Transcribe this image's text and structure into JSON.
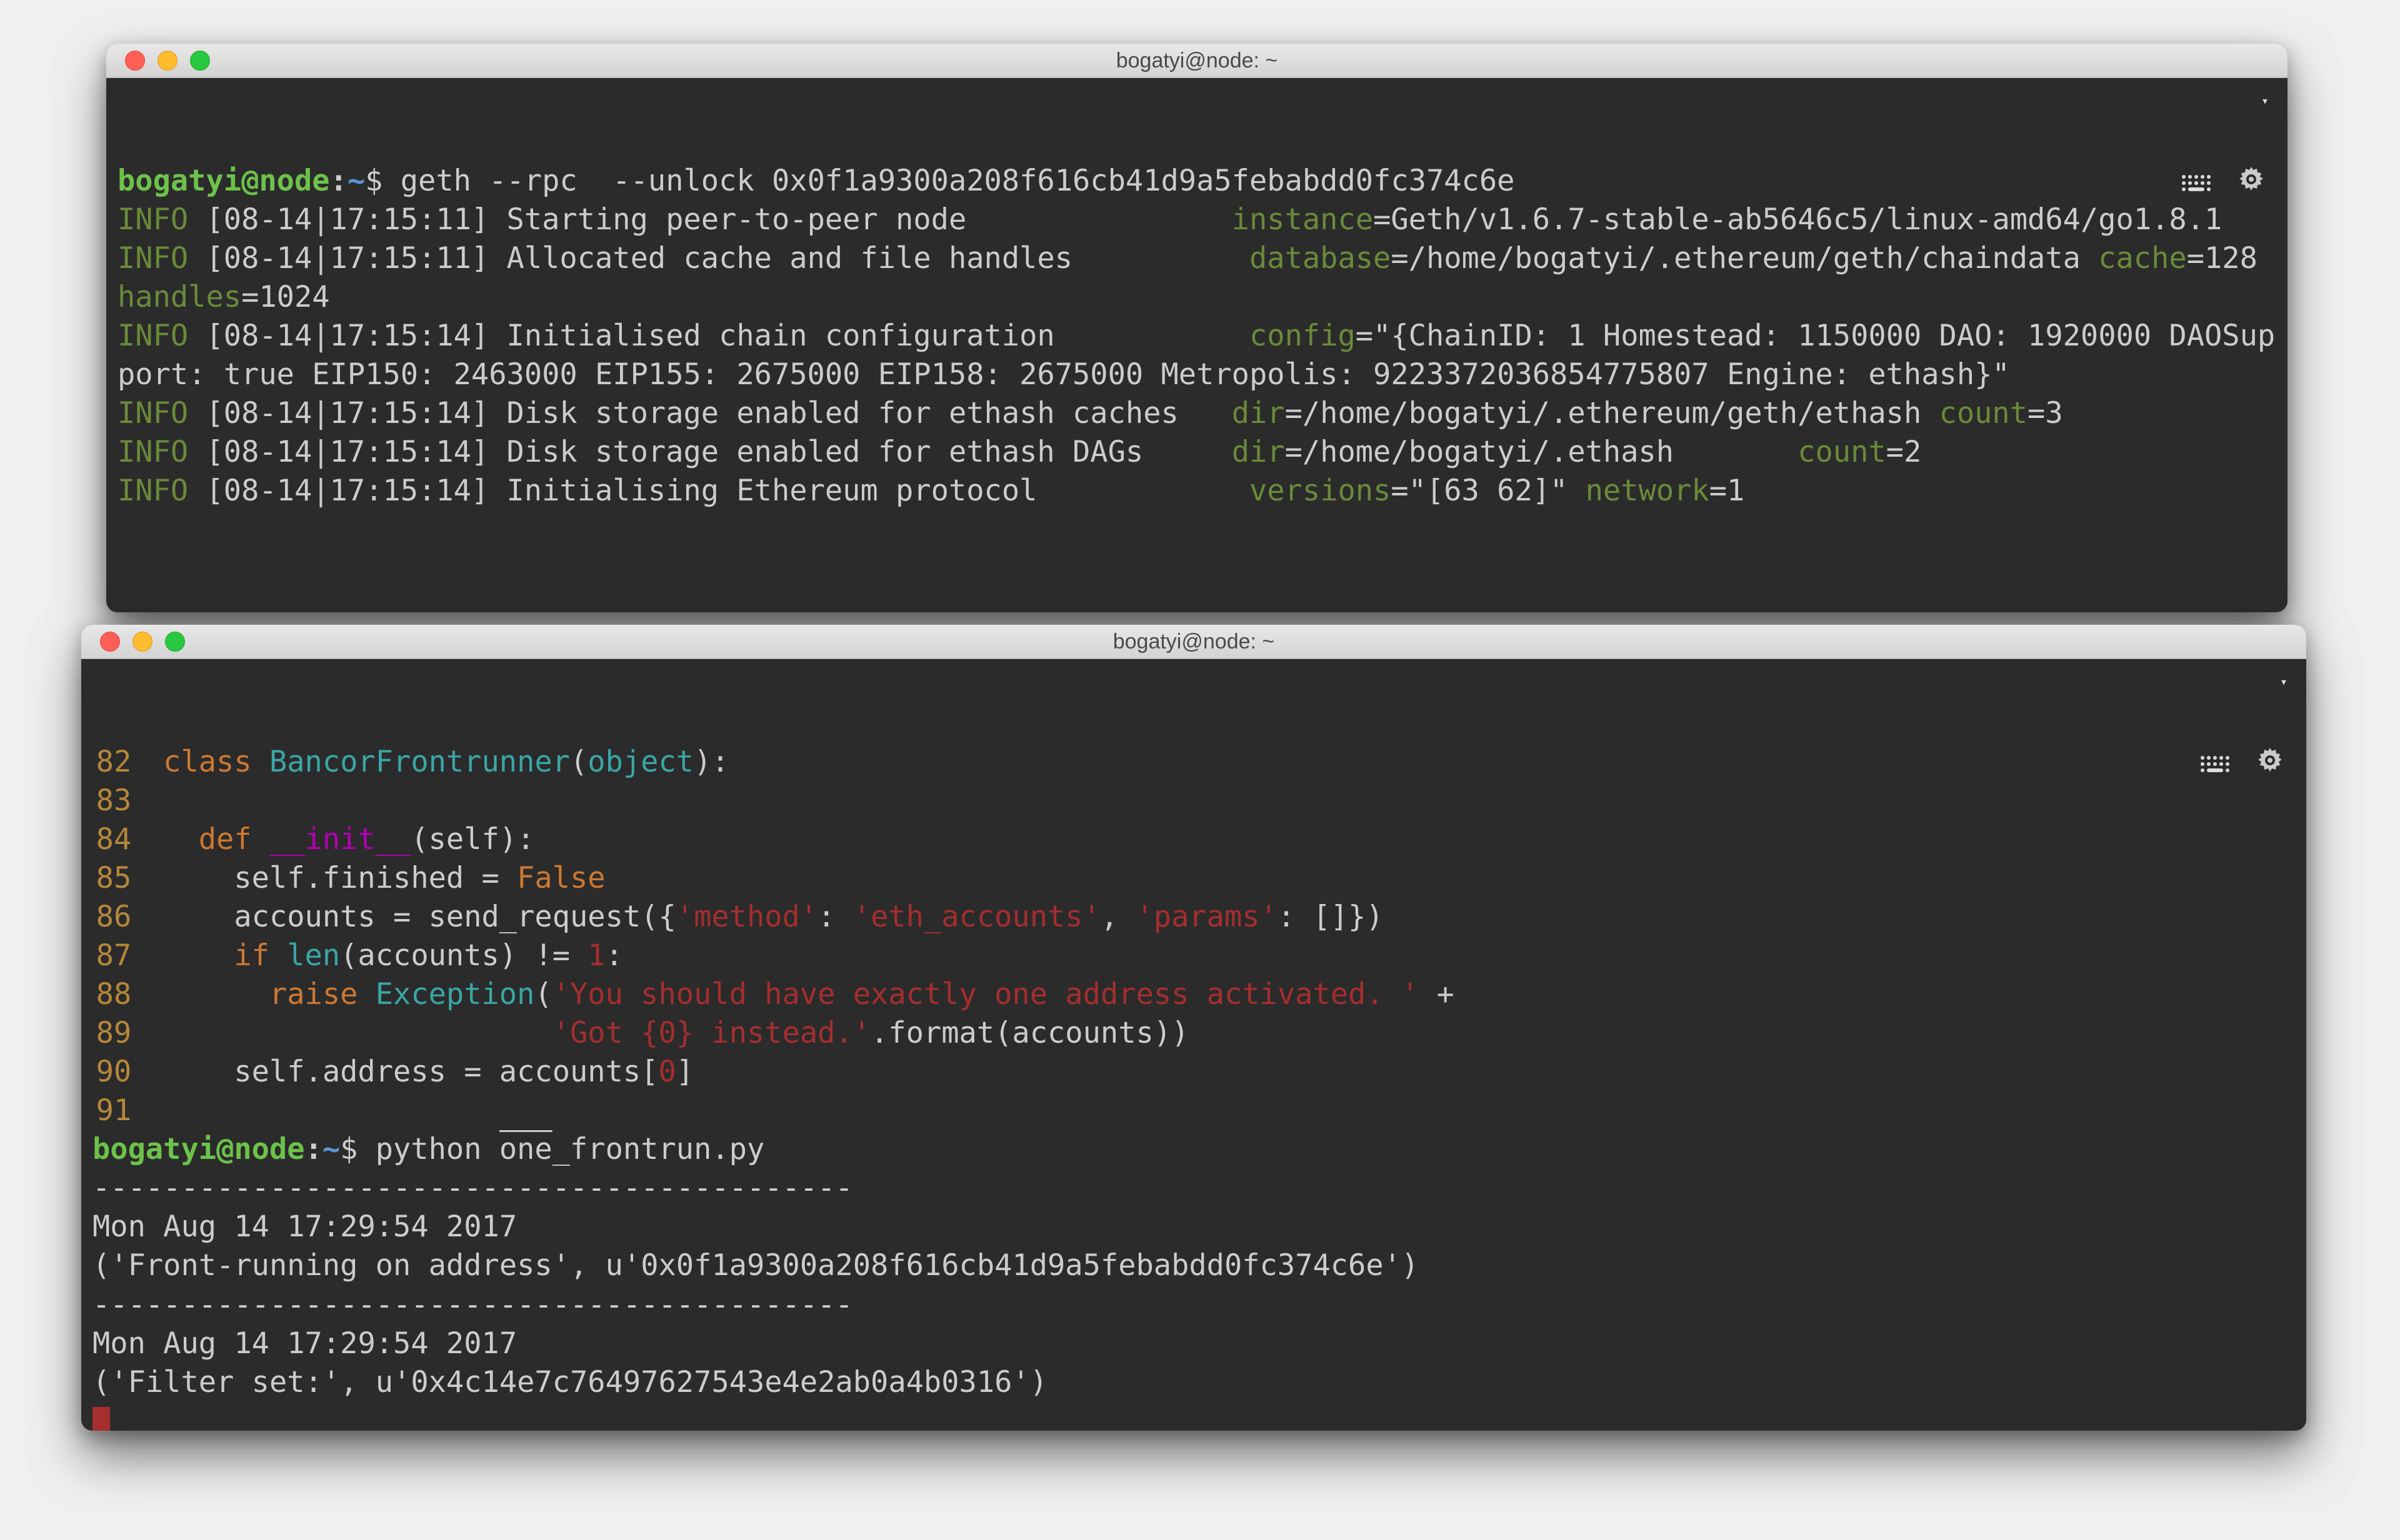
{
  "win1": {
    "title": "bogatyi@node: ~",
    "prompt": {
      "user": "bogatyi@node",
      "sep": ":",
      "path": "~",
      "sym": "$"
    },
    "cmd": "geth --rpc  --unlock 0x0f1a9300a208f616cb41d9a5febabdd0fc374c6e",
    "log": {
      "l1": {
        "lvl": "INFO",
        "ts": "[08-14|17:15:11]",
        "msg": "Starting peer-to-peer node",
        "k": "instance",
        "v": "=Geth/v1.6.7-stable-ab5646c5/linux-amd64/go1.8.1"
      },
      "l2": {
        "lvl": "INFO",
        "ts": "[08-14|17:15:11]",
        "msg": "Allocated cache and file handles",
        "k": "database",
        "v": "=/home/bogatyi/.ethereum/geth/chaindata",
        "k2": "cache",
        "v2": "=128",
        "k3": "handles",
        "v3": "=1024"
      },
      "l3": {
        "lvl": "INFO",
        "ts": "[08-14|17:15:14]",
        "msg": "Initialised chain configuration",
        "k": "config",
        "v": "=\"{ChainID: 1 Homestead: 1150000 DAO: 1920000 DAOSupport: true EIP150: 2463000 EIP155: 2675000 EIP158: 2675000 Metropolis: 9223372036854775807 Engine: ethash}\""
      },
      "l4": {
        "lvl": "INFO",
        "ts": "[08-14|17:15:14]",
        "msg": "Disk storage enabled for ethash caches",
        "k": "dir",
        "v": "=/home/bogatyi/.ethereum/geth/ethash",
        "k2": "count",
        "v2": "=3"
      },
      "l5": {
        "lvl": "INFO",
        "ts": "[08-14|17:15:14]",
        "msg": "Disk storage enabled for ethash DAGs",
        "k": "dir",
        "v": "=/home/bogatyi/.ethash",
        "k2": "count",
        "v2": "=2"
      },
      "l6": {
        "lvl": "INFO",
        "ts": "[08-14|17:15:14]",
        "msg": "Initialising Ethereum protocol",
        "k": "versions",
        "v": "=\"[63 62]\"",
        "k2": "network",
        "v2": "=1"
      }
    }
  },
  "win2": {
    "title": "bogatyi@node: ~",
    "code": {
      "ln82": "82",
      "kw_class": "class",
      "cls": "BancorFrontrunner",
      "obj": "object",
      "ln83": "83",
      "ln84": "84",
      "kw_def": "def",
      "fn": "__init__",
      "arg_self": "self",
      "ln85": "85",
      "l85_a": "self.finished = ",
      "l85_b": "False",
      "ln86": "86",
      "l86_a": "accounts = send_request({",
      "l86_s1": "'method'",
      "l86_b": ": ",
      "l86_s2": "'eth_accounts'",
      "l86_c": ", ",
      "l86_s3": "'params'",
      "l86_d": ": []})",
      "ln87": "87",
      "l87_a": "if",
      "l87_b": " len",
      "l87_c": "(accounts) != ",
      "l87_n": "1",
      "l87_d": ":",
      "ln88": "88",
      "l88_a": "raise",
      "l88_b": " Exception",
      "l88_c": "(",
      "l88_s": "'You should have exactly one address activated. '",
      "l88_d": " +",
      "ln89": "89",
      "l89_s": "'Got {0} instead.'",
      "l89_a": ".format(accounts))",
      "ln90": "90",
      "l90_a": "self.address = accounts[",
      "l90_n": "0",
      "l90_b": "]",
      "ln91": "91"
    },
    "prompt": {
      "user": "bogatyi@node",
      "sep": ":",
      "path": "~",
      "sym": "$"
    },
    "cmd2": "python one_frontrun.py",
    "cmd2_cursor_part": "one",
    "out": {
      "div": "-------------------------------------------",
      "ts1": "Mon Aug 14 17:29:54 2017",
      "o1": "('Front-running on address', u'0x0f1a9300a208f616cb41d9a5febabdd0fc374c6e')",
      "div2": "-------------------------------------------",
      "ts2": "Mon Aug 14 17:29:54 2017",
      "o2": "('Filter set:', u'0x4c14e7c76497627543e4e2ab0a4b0316')"
    }
  }
}
